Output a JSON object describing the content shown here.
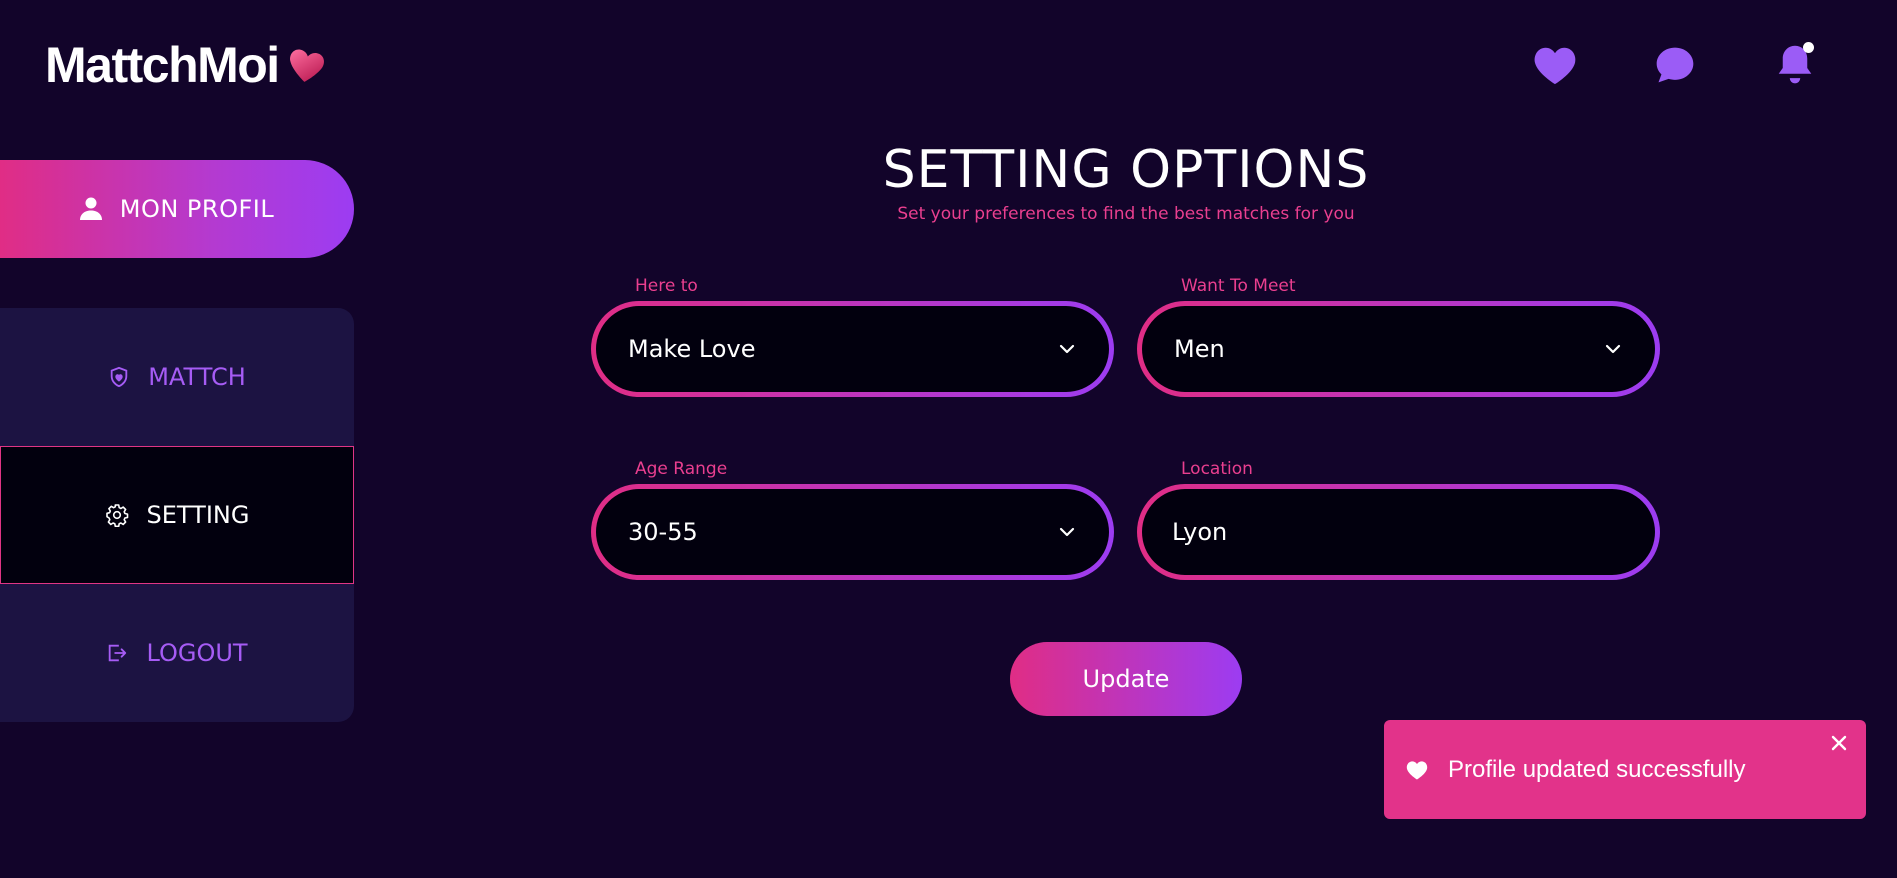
{
  "brand": {
    "name": "MattchMoi",
    "logo_icon": "heart-icon"
  },
  "header": {
    "icons": [
      "heart-icon",
      "chat-bubble-icon",
      "bell-icon"
    ],
    "has_notification": true
  },
  "sidebar": {
    "profile": {
      "label": "MON PROFIL",
      "icon": "user-icon"
    },
    "items": [
      {
        "label": "MATTCH",
        "icon": "heart-shield-icon",
        "active": false
      },
      {
        "label": "SETTING",
        "icon": "gear-icon",
        "active": true
      },
      {
        "label": "LOGOUT",
        "icon": "logout-icon",
        "active": false
      }
    ]
  },
  "page": {
    "title": "SETTING OPTIONS",
    "subtitle": "Set your preferences to find the best matches for you"
  },
  "form": {
    "here_to": {
      "label": "Here to",
      "value": "Make Love"
    },
    "want_to_meet": {
      "label": "Want To Meet",
      "value": "Men"
    },
    "age_range": {
      "label": "Age Range",
      "value": "30-55"
    },
    "location": {
      "label": "Location",
      "value": "Lyon"
    },
    "update_label": "Update"
  },
  "toast": {
    "message": "Profile updated successfully",
    "icon": "heart-icon",
    "close_icon": "close-icon"
  },
  "colors": {
    "background": "#12042a",
    "accent_pink": "#e02d85",
    "accent_purple": "#9c3cf2",
    "nav_panel": "#1c1342",
    "toast": "#e2338a"
  }
}
